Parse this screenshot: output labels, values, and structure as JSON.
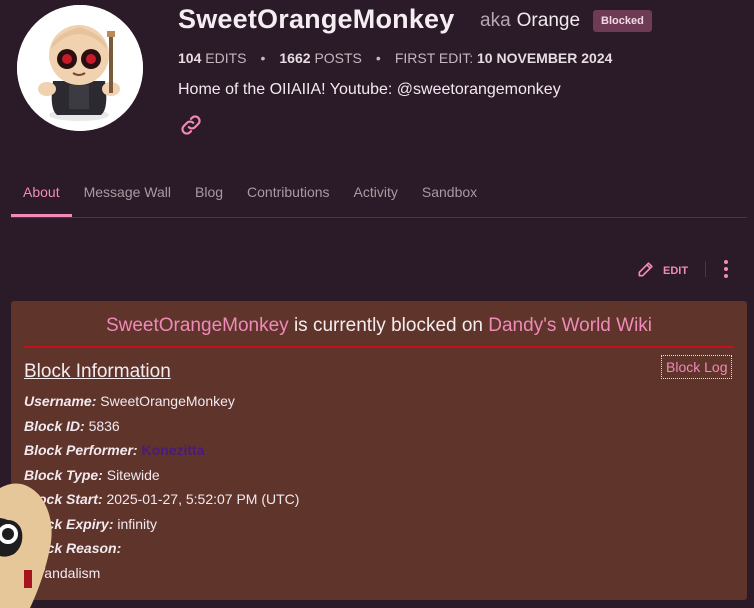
{
  "profile": {
    "username": "SweetOrangeMonkey",
    "aka_label": "aka",
    "aka_name": "Orange",
    "status_badge": "Blocked",
    "edits_count": "104",
    "edits_label": "EDITS",
    "posts_count": "1662",
    "posts_label": "POSTS",
    "first_edit_label": "FIRST EDIT:",
    "first_edit_date": "10 NOVEMBER 2024",
    "bio": "Home of the OIIAIIA! Youtube: @sweetorangemonkey"
  },
  "tabs": [
    {
      "label": "About",
      "active": true
    },
    {
      "label": "Message Wall",
      "active": false
    },
    {
      "label": "Blog",
      "active": false
    },
    {
      "label": "Contributions",
      "active": false
    },
    {
      "label": "Activity",
      "active": false
    },
    {
      "label": "Sandbox",
      "active": false
    }
  ],
  "actions": {
    "edit_label": "EDIT"
  },
  "block_notice": {
    "user_link": "SweetOrangeMonkey",
    "middle_text": " is currently blocked on ",
    "wiki_link": "Dandy's World Wiki",
    "heading": "Block Information",
    "block_log_button": "Block Log",
    "rows": [
      {
        "label": "Username:",
        "value": "SweetOrangeMonkey"
      },
      {
        "label": "Block ID:",
        "value": "5836"
      },
      {
        "label": "Block Performer:",
        "value": "Konezitta"
      },
      {
        "label": "Block Type:",
        "value": "Sitewide"
      },
      {
        "label": "Block Start:",
        "value": "2025-01-27, 5:52:07 PM (UTC)"
      },
      {
        "label": "Block Expiry:",
        "value": "infinity"
      },
      {
        "label": "Block Reason:",
        "value": ""
      }
    ],
    "reason_text": "Vandalism"
  },
  "colors": {
    "page_bg": "#2b1a27",
    "accent": "#f08ab8",
    "badge_bg": "#6d3b55",
    "panel_bg": "#5e342b",
    "rule_red": "#c8101c"
  },
  "icons": {
    "link": "link-chain-icon",
    "edit": "pencil-icon",
    "more": "kebab-menu-icon"
  }
}
